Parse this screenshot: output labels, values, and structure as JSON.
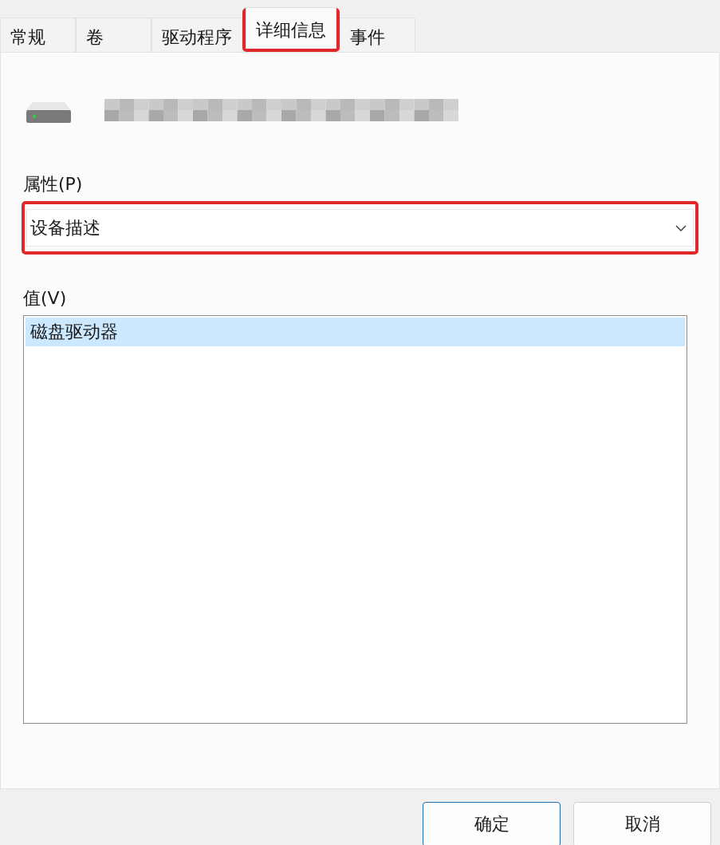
{
  "tabs": [
    {
      "label": "常规",
      "selected": false,
      "highlighted": false
    },
    {
      "label": "卷",
      "selected": false,
      "highlighted": false
    },
    {
      "label": "驱动程序",
      "selected": false,
      "highlighted": false
    },
    {
      "label": "详细信息",
      "selected": true,
      "highlighted": true
    },
    {
      "label": "事件",
      "selected": false,
      "highlighted": false
    }
  ],
  "property": {
    "label": "属性(P)",
    "value": "设备描述",
    "highlighted": true
  },
  "values": {
    "label": "值(V)",
    "items": [
      {
        "text": "磁盘驱动器",
        "selected": true
      }
    ]
  },
  "buttons": [
    "确定",
    "取消"
  ]
}
